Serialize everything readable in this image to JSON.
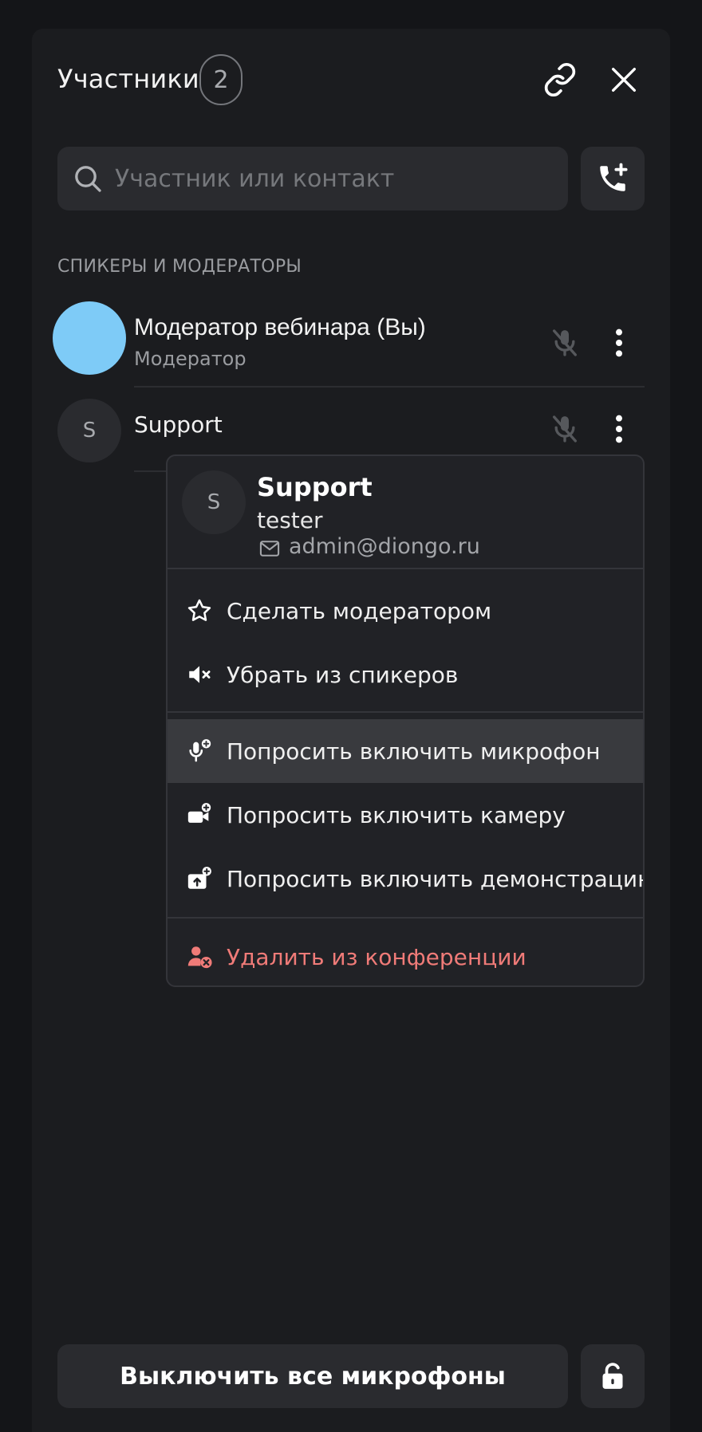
{
  "panel": {
    "title": "Участники",
    "count": "2"
  },
  "search": {
    "placeholder": "Участник или контакт",
    "value": ""
  },
  "section_label": "СПИКЕРЫ И МОДЕРАТОРЫ",
  "participants": [
    {
      "name": "Модератор вебинара (Вы)",
      "role": "Модератор",
      "avatar_color": "#7ecbf7"
    },
    {
      "name": "Support",
      "role": "",
      "avatar_letter": "S"
    }
  ],
  "context_menu": {
    "avatar_letter": "S",
    "name": "Support",
    "subtitle": "tester",
    "email": "admin@diongo.ru",
    "items": [
      {
        "label": "Сделать модератором",
        "icon": "star-icon"
      },
      {
        "label": "Убрать из спикеров",
        "icon": "speaker-off-icon"
      },
      {
        "label": "Попросить включить микрофон",
        "icon": "mic-request-icon",
        "active": true
      },
      {
        "label": "Попросить включить камеру",
        "icon": "camera-request-icon"
      },
      {
        "label": "Попросить включить демонстрацию",
        "icon": "screen-share-request-icon"
      },
      {
        "label": "Удалить из конференции",
        "icon": "remove-user-icon",
        "danger_color": "#f07b78"
      }
    ]
  },
  "footer": {
    "mute_all_label": "Выключить все микрофоны"
  },
  "colors": {
    "background": "#141518",
    "panel": "#1b1c1f",
    "surface": "#2a2b2f",
    "danger": "#f07b78"
  }
}
